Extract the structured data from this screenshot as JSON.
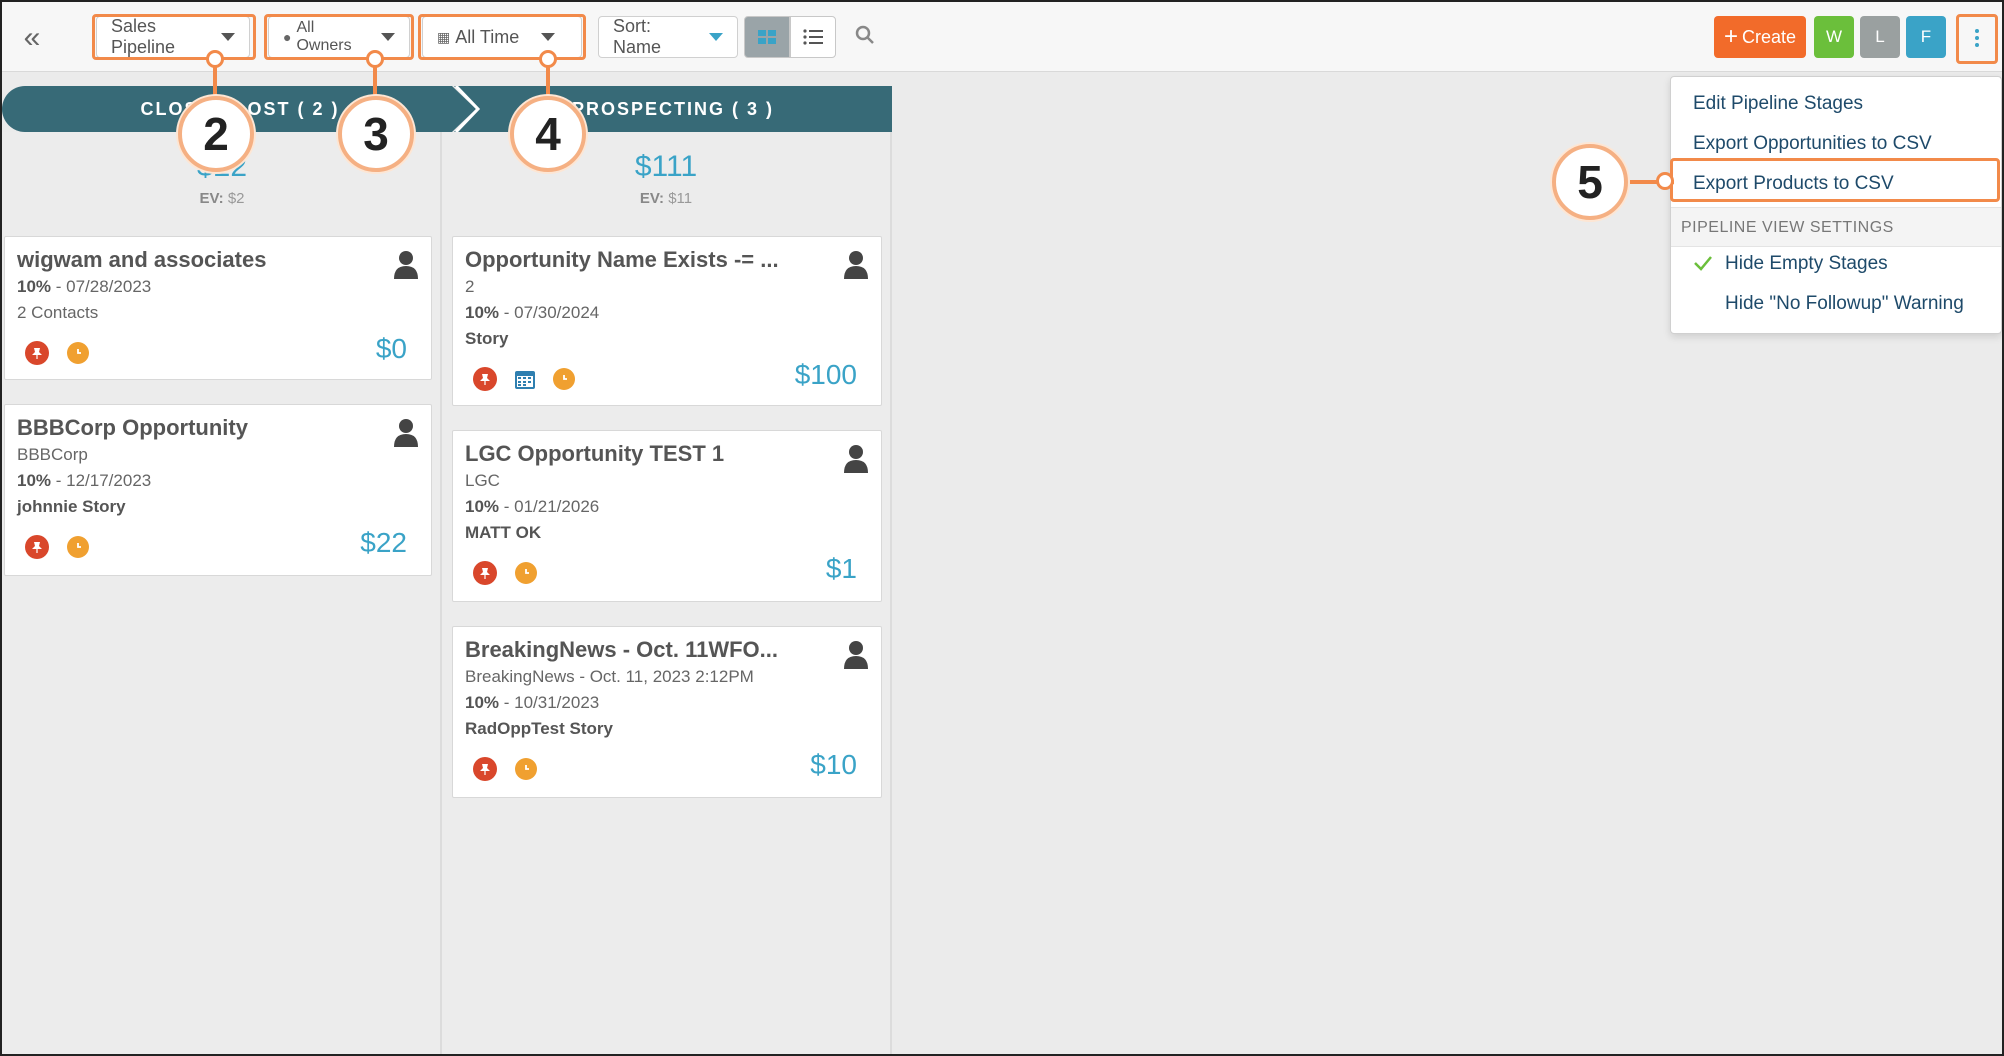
{
  "toolbar": {
    "pipeline_select": "Sales Pipeline",
    "owner_select": "All Owners",
    "time_select": "All Time",
    "sort_select": "Sort: Name",
    "create_label": "Create",
    "user_buttons": [
      "W",
      "L",
      "F"
    ],
    "user_colors": [
      "#6bbf3b",
      "#9aa0a0",
      "#3aa3c7"
    ]
  },
  "stages": [
    {
      "label": "CLOSED LOST ( 2 )",
      "amount": "$22",
      "ev_label": "EV:",
      "ev_value": "$2"
    },
    {
      "label": "PROSPECTING ( 3 )",
      "amount": "$111",
      "ev_label": "EV:",
      "ev_value": "$11"
    }
  ],
  "cards_col1": [
    {
      "title": "wigwam and associates",
      "pct": "10%",
      "date": " - 07/28/2023",
      "line3": "2 Contacts",
      "amount": "$0"
    },
    {
      "title": "BBBCorp Opportunity",
      "company": "BBBCorp",
      "pct": "10%",
      "date": " - 12/17/2023",
      "owner": "johnnie Story",
      "amount": "$22"
    }
  ],
  "cards_col2": [
    {
      "title": "Opportunity Name Exists -= ...",
      "company": "2",
      "pct": "10%",
      "date": " - 07/30/2024",
      "owner": "Story",
      "amount": "$100"
    },
    {
      "title": "LGC Opportunity TEST 1",
      "company": "LGC",
      "pct": "10%",
      "date": " - 01/21/2026",
      "owner": "MATT OK",
      "amount": "$1"
    },
    {
      "title": "BreakingNews - Oct. 11WFO...",
      "company": "BreakingNews - Oct. 11, 2023 2:12PM",
      "pct": "10%",
      "date": " - 10/31/2023",
      "owner": "RadOppTest Story",
      "amount": "$10"
    }
  ],
  "menu": {
    "items": [
      "Edit Pipeline Stages",
      "Export Opportunities to CSV",
      "Export Products to CSV"
    ],
    "section_header": "PIPELINE VIEW SETTINGS",
    "settings": [
      "Hide Empty Stages",
      "Hide \"No Followup\" Warning"
    ]
  },
  "callouts": [
    "2",
    "3",
    "4",
    "5"
  ],
  "colors": {
    "accent": "#3aa3c7",
    "highlight": "#f28a4a",
    "stage": "#376a77",
    "create": "#f26b2a"
  }
}
